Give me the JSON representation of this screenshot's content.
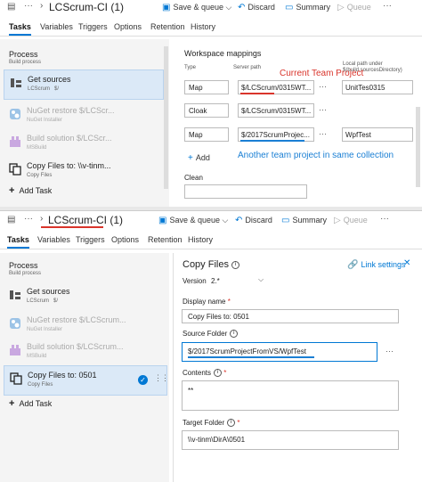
{
  "top": {
    "title": "LCScrum-CI (1)",
    "toolbar": {
      "save": "Save & queue",
      "discard": "Discard",
      "summary": "Summary",
      "queue": "Queue"
    },
    "tabs": [
      "Tasks",
      "Variables",
      "Triggers",
      "Options",
      "Retention",
      "History"
    ],
    "process": {
      "title": "Process",
      "sub": "Build process"
    },
    "tasks": [
      {
        "name": "Get sources",
        "sub": "LCScrum",
        "sub2": "$/"
      },
      {
        "name": "NuGet restore $/LCScr...",
        "sub": "NuGet Installer"
      },
      {
        "name": "Build solution $/LCScr...",
        "sub": "MSBuild"
      },
      {
        "name": "Copy Files to: \\\\v-tinm...",
        "sub": "Copy Files"
      }
    ],
    "add_task": "Add Task",
    "workspace": {
      "title": "Workspace mappings",
      "col_type": "Type",
      "col_server": "Server path",
      "col_local": "Local path under $(build.sourcesDirectory)",
      "rows": [
        {
          "type": "Map",
          "server": "$/LCScrum/0315WT...",
          "local": "UnitTes0315"
        },
        {
          "type": "Cloak",
          "server": "$/LCScrum/0315WT...",
          "local": ""
        },
        {
          "type": "Map",
          "server": "$/2017ScrumProjec...",
          "local": "WpfTest"
        }
      ],
      "add": "Add",
      "clean": "Clean"
    },
    "annot_current": "Current Team Project",
    "annot_another": "Another team project in same collection"
  },
  "bottom": {
    "title": "LCScrum-CI (1)",
    "toolbar": {
      "save": "Save & queue",
      "discard": "Discard",
      "summary": "Summary",
      "queue": "Queue"
    },
    "tabs": [
      "Tasks",
      "Variables",
      "Triggers",
      "Options",
      "Retention",
      "History"
    ],
    "process": {
      "title": "Process",
      "sub": "Build process"
    },
    "tasks": [
      {
        "name": "Get sources",
        "sub": "LCScrum",
        "sub2": "$/"
      },
      {
        "name": "NuGet restore $/LCScrum...",
        "sub": "NuGet Installer"
      },
      {
        "name": "Build solution $/LCScrum...",
        "sub": "MSBuild"
      },
      {
        "name": "Copy Files to: 0501",
        "sub": "Copy Files"
      }
    ],
    "add_task": "Add Task",
    "details": {
      "title": "Copy Files",
      "link_settings": "Link settings",
      "version_label": "Version",
      "version_value": "2.*",
      "display_name_label": "Display name",
      "display_name_value": "Copy Files to: 0501",
      "source_folder_label": "Source Folder",
      "source_folder_value": "$/2017ScrumProjectFromVS/WpfTest",
      "contents_label": "Contents",
      "contents_value": "**",
      "target_folder_label": "Target Folder",
      "target_folder_value": "\\\\v-tinm\\DirA\\0501"
    }
  },
  "colors": {
    "accent": "#0078d4",
    "annot_red": "#d9342b",
    "annot_blue": "#1a7fd4",
    "selected_bg": "#dbe9f7"
  }
}
